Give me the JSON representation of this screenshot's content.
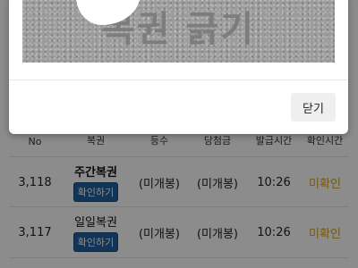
{
  "modal": {
    "scratch_title": "복권 긁기",
    "close_label": "닫기"
  },
  "table": {
    "headers": {
      "no": "No",
      "ticket": "복권",
      "rank": "등수",
      "prize": "당첨금",
      "issued_time": "발급시간",
      "check_time": "확인시간"
    },
    "rows": [
      {
        "no": "3,118",
        "ticket": "주간복권",
        "button": "확인하기",
        "rank": "(미개봉)",
        "prize": "(미개봉)",
        "issued_time": "10:26",
        "check_time": "미확인"
      },
      {
        "no": "3,117",
        "ticket": "일일복권",
        "button": "확인하기",
        "rank": "(미개봉)",
        "prize": "(미개봉)",
        "issued_time": "10:26",
        "check_time": "미확인"
      }
    ]
  },
  "colors": {
    "confirm_button": "#1f5f9e",
    "status_unchecked": "#d4a21a",
    "scratch_surface": "#9c9c9c"
  }
}
